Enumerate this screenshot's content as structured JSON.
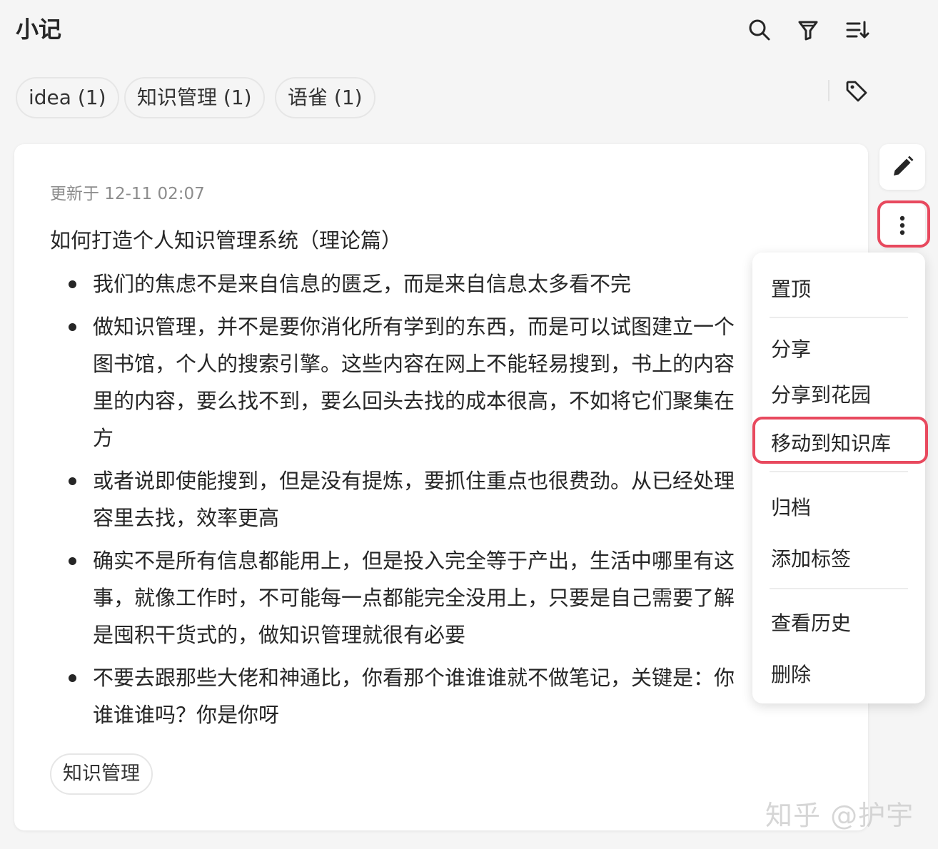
{
  "header": {
    "title": "小记",
    "icons": [
      "search-icon",
      "filter-icon",
      "sort-icon"
    ]
  },
  "filters": {
    "chips": [
      "idea (1)",
      "知识管理 (1)",
      "语雀 (1)"
    ],
    "tag_icon": "tag-icon"
  },
  "note": {
    "updated": "更新于 12-11 02:07",
    "title": "如何打造个人知识管理系统（理论篇）",
    "bullets": [
      [
        "我们的焦虑不是来自信息的匮乏，而是来自信息太多看不完"
      ],
      [
        "做知识管理，并不是要你消化所有学到的东西，而是可以试图建立一个",
        "图书馆，个人的搜索引擎。这些内容在网上不能轻易搜到，书上的内容",
        "里的内容，要么找不到，要么回头去找的成本很高，不如将它们聚集在",
        "方"
      ],
      [
        "或者说即使能搜到，但是没有提炼，要抓住重点也很费劲。从已经处理",
        "容里去找，效率更高"
      ],
      [
        "确实不是所有信息都能用上，但是投入完全等于产出，生活中哪里有这",
        "事，就像工作时，不可能每一点都能完全没用上，只要是自己需要了解",
        "是囤积干货式的，做知识管理就很有必要"
      ],
      [
        "不要去跟那些大佬和神通比，你看那个谁谁谁就不做笔记，关键是：你",
        "谁谁谁吗？你是你呀"
      ]
    ],
    "tag": "知识管理"
  },
  "side": {
    "edit_icon": "pencil-icon",
    "more_icon": "more-vertical-icon"
  },
  "menu": {
    "items": [
      "置顶",
      "分享",
      "分享到花园",
      "移动到知识库",
      "归档",
      "添加标签",
      "查看历史",
      "删除"
    ],
    "highlighted": "移动到知识库"
  },
  "colors": {
    "highlight": "#e8495e",
    "background": "#f5f5f5",
    "card": "#ffffff"
  },
  "watermark": "知乎 @护宇"
}
